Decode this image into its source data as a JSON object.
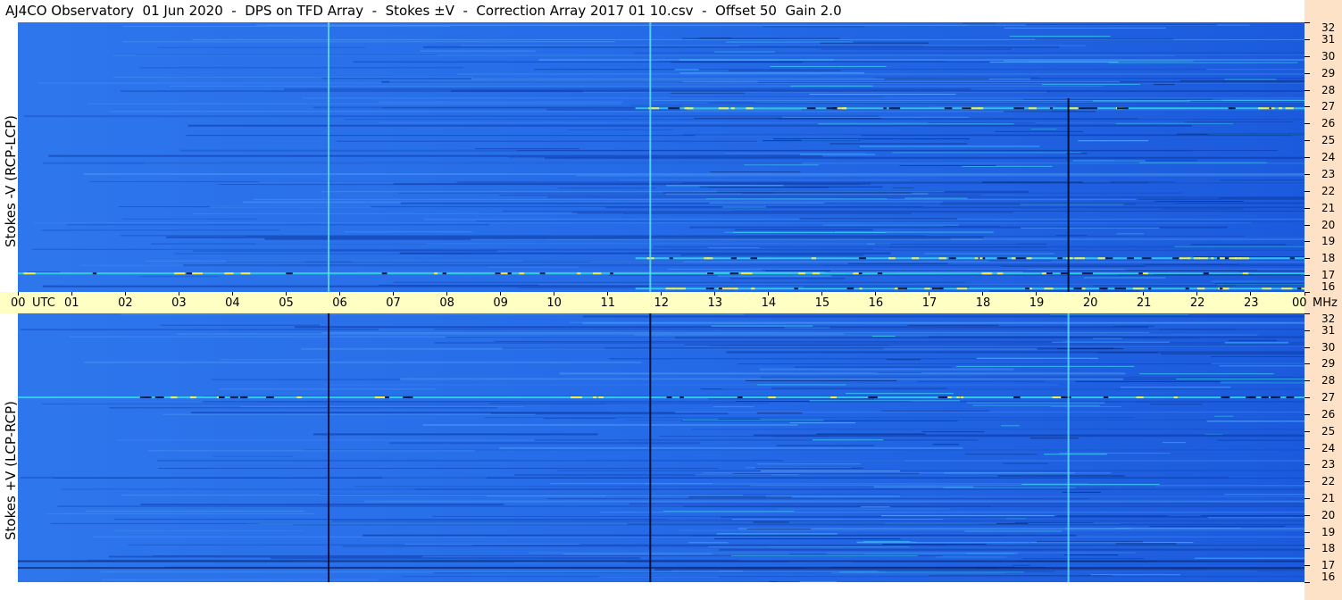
{
  "title": "AJ4CO Observatory  01 Jun 2020  -  DPS on TFD Array  -  Stokes ±V  -  Correction Array 2017 01 10.csv  -  Offset 50  Gain 2.0",
  "colors": {
    "background": "#1f63e6",
    "time_axis_band": "#ffffc4",
    "freq_axis_band": "#fde2c8"
  },
  "chart_data": [
    {
      "type": "heatmap",
      "name": "top-spectrogram",
      "ylabel": "Stokes -V (RCP-LCP)",
      "freq_range_mhz": [
        16,
        32
      ],
      "freq_ticks": [
        16,
        17,
        18,
        19,
        20,
        21,
        22,
        23,
        24,
        25,
        26,
        27,
        28,
        29,
        30,
        31,
        32
      ],
      "time_range_utc_hours": [
        0,
        24
      ],
      "vertical_bright_lines_utc": [
        5.78,
        11.78
      ],
      "vertical_dark_lines_utc": [
        19.58
      ],
      "bright_bands_mhz": [
        17.1,
        16.2,
        26.9,
        18.0
      ]
    },
    {
      "type": "heatmap",
      "name": "bottom-spectrogram",
      "ylabel": "Stokes +V (LCP-RCP)",
      "freq_range_mhz": [
        16,
        32
      ],
      "freq_ticks": [
        16,
        17,
        18,
        19,
        20,
        21,
        22,
        23,
        24,
        25,
        26,
        27,
        28,
        29,
        30,
        31,
        32
      ],
      "time_range_utc_hours": [
        0,
        24
      ],
      "vertical_dark_lines_utc": [
        5.78,
        11.78
      ],
      "vertical_bright_lines_utc": [
        19.58
      ],
      "bright_bands_mhz": [
        27.0
      ]
    }
  ],
  "time_axis": {
    "labels": [
      "00",
      "01",
      "02",
      "03",
      "04",
      "05",
      "06",
      "07",
      "08",
      "09",
      "10",
      "11",
      "12",
      "13",
      "14",
      "15",
      "16",
      "17",
      "18",
      "19",
      "20",
      "21",
      "22",
      "23",
      "00"
    ],
    "utc_label": "UTC",
    "mhz_label": "MHz"
  }
}
